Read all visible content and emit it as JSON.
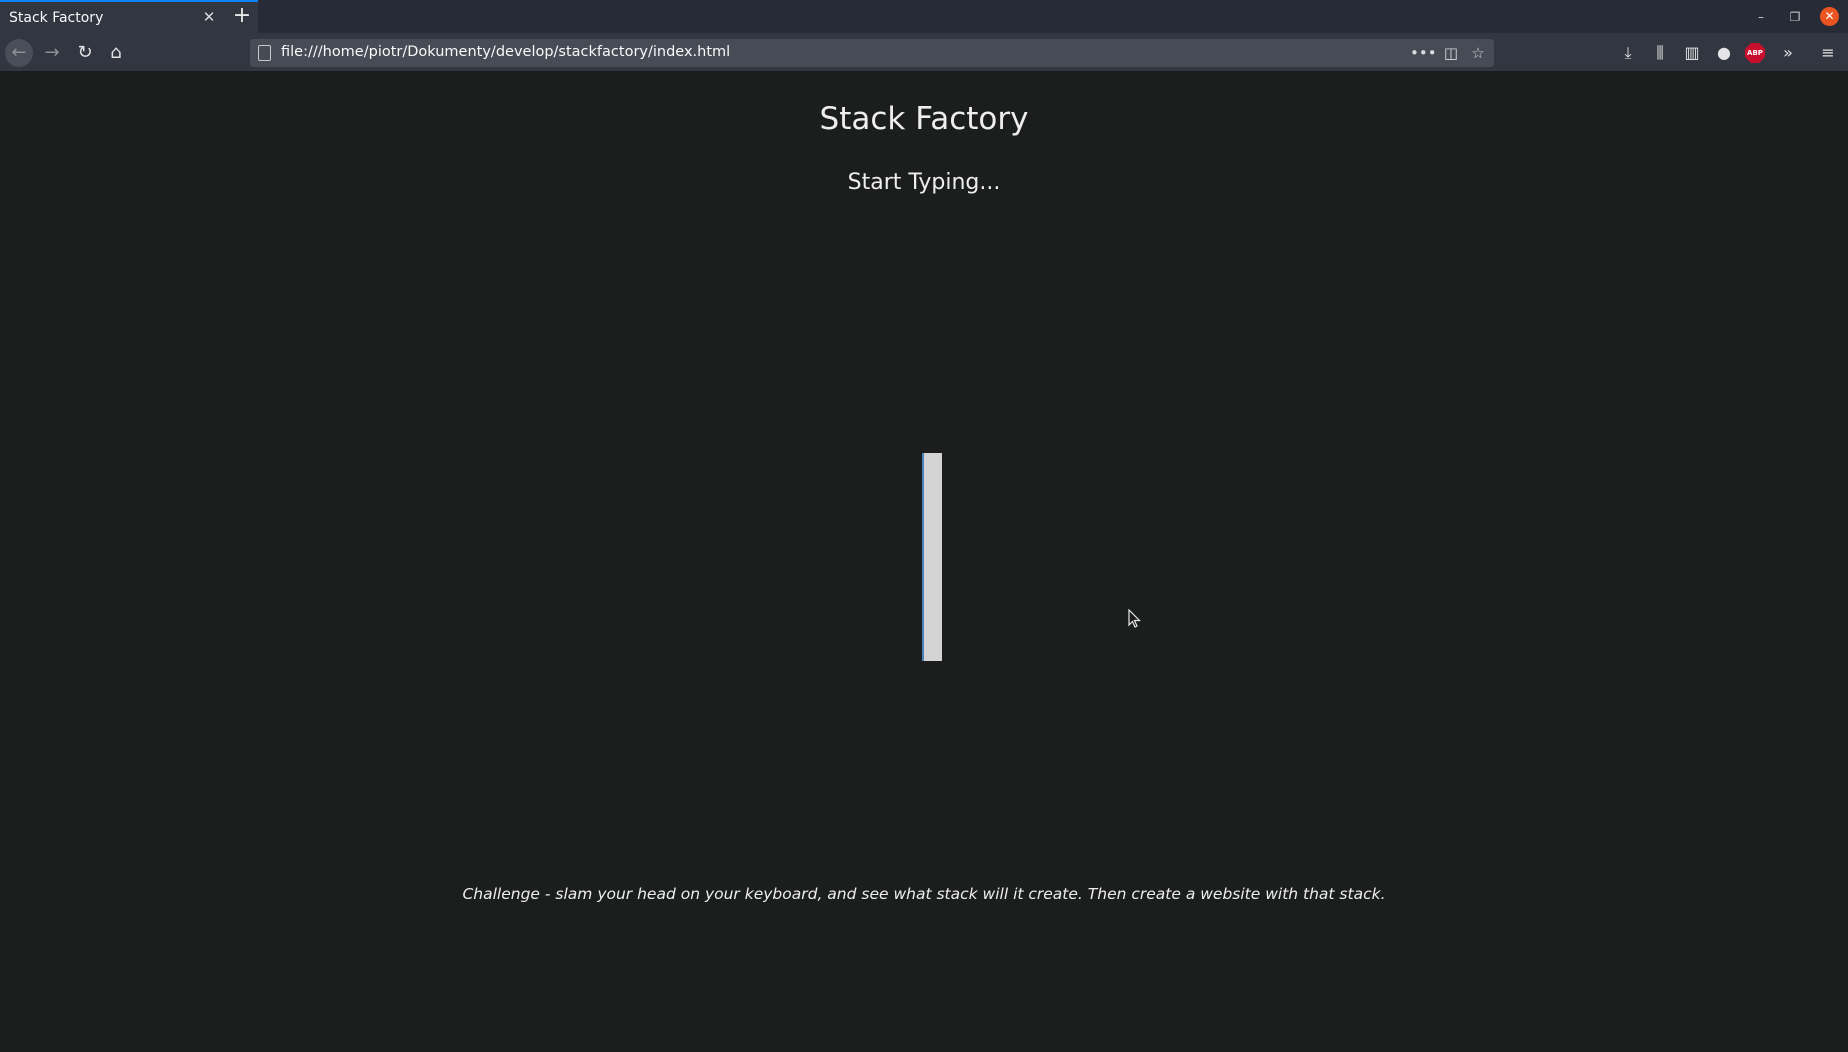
{
  "browser": {
    "tab": {
      "title": "Stack Factory",
      "close_icon": "close-icon"
    },
    "new_tab_icon": "plus-icon",
    "url": "file:///home/piotr/Dokumenty/develop/stackfactory/index.html",
    "abp_label": "ABP"
  },
  "page": {
    "title": "Stack Factory",
    "subtitle": "Start Typing...",
    "challenge": "Challenge - slam your head on your keyboard, and see what stack will it create. Then create a website with that stack."
  }
}
